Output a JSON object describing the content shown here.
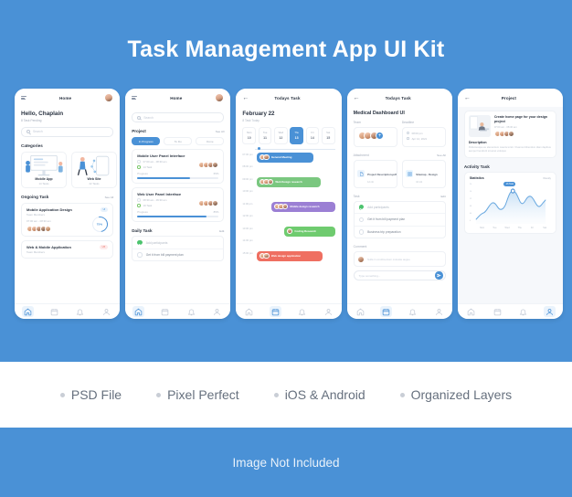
{
  "hero": {
    "title": "Task Management App UI Kit"
  },
  "features": [
    {
      "label": "PSD File"
    },
    {
      "label": "Pixel Perfect"
    },
    {
      "label": "iOS & Android"
    },
    {
      "label": "Organized Layers"
    }
  ],
  "footer": {
    "text": "Image Not Included"
  },
  "colors": {
    "background_blue": "#4a91d6",
    "accent": "#4a91d6",
    "card_white": "#ffffff",
    "screen_bg": "#f6f8fb",
    "muted_text": "#b2bac6",
    "green": "#7ac77f",
    "purple": "#9b7fd4",
    "red": "#ef6f61"
  },
  "screens": [
    {
      "id": "home",
      "topbar": {
        "title": "Home",
        "left_icon": "hamburger-icon",
        "right_icon": "avatar"
      },
      "greeting": "Hello, Chaplain",
      "greeting_sub": "8 Task Pending",
      "search_placeholder": "Search",
      "categories_title": "Categories",
      "categories": [
        {
          "name": "Mobile App",
          "count": "14 Tasks"
        },
        {
          "name": "Web Site",
          "count": "22 Tasks"
        }
      ],
      "ongoing_title": "Ongoing Task",
      "ongoing_link": "See All",
      "tasks": [
        {
          "title": "Mobile Application Design",
          "sub": "Team Members",
          "time": "07:00 am - 08:30 am",
          "badge": "UI",
          "progress": "75%"
        },
        {
          "title": "Web & Mobile Application",
          "sub": "Team Members",
          "badge": "UX"
        }
      ],
      "nav": [
        "home-icon",
        "calendar-icon",
        "bell-icon",
        "profile-icon"
      ],
      "nav_active": 0
    },
    {
      "id": "project",
      "topbar": {
        "title": "Home",
        "left_icon": "hamburger-icon",
        "right_icon": "avatar"
      },
      "search_placeholder": "Search",
      "project_title": "Project",
      "project_link": "See All",
      "chips": [
        {
          "label": "In Progress",
          "active": true
        },
        {
          "label": "To Do",
          "active": false
        },
        {
          "label": "Done",
          "active": false
        }
      ],
      "projects": [
        {
          "title": "Mobile User Panel Interface",
          "time": "07:00 am - 08:30 am",
          "tasks": "14 Task",
          "progress_label": "Progress",
          "progress": "65%",
          "progress_pct": 65
        },
        {
          "title": "Web User Panel Interface",
          "time": "08:30 am - 09:30 am",
          "tasks": "19 Task",
          "progress_label": "Progress",
          "progress": "85%",
          "progress_pct": 85
        }
      ],
      "daily_title": "Daily Task",
      "daily_link": "Edit",
      "daily_items": [
        {
          "label": "Add participants",
          "done": true
        },
        {
          "label": "Get it from bill payment plan",
          "done": false
        }
      ],
      "nav": [
        "home-icon",
        "calendar-icon",
        "bell-icon",
        "profile-icon"
      ],
      "nav_active": 0
    },
    {
      "id": "todays-task-calendar",
      "topbar": {
        "title": "Todays Task",
        "left_icon": "back-arrow-icon"
      },
      "month_title": "February 22",
      "month_sub": "8 Task Today",
      "days": [
        {
          "name": "Mon",
          "num": "10",
          "selected": false
        },
        {
          "name": "Tue",
          "num": "11",
          "selected": false
        },
        {
          "name": "Wed",
          "num": "12",
          "selected": false
        },
        {
          "name": "Thu",
          "num": "13",
          "selected": true
        },
        {
          "name": "Fri",
          "num": "14",
          "selected": false
        },
        {
          "name": "Sat",
          "num": "15",
          "selected": false
        }
      ],
      "timeline": [
        {
          "time": "07:00 pm",
          "event": "General Meeting",
          "color": "#4a91d6",
          "indent": 0,
          "width": 62,
          "faces": 2
        },
        {
          "time": "08:00 pm",
          "event": "",
          "color": "",
          "indent": 0,
          "width": 0,
          "faces": 0
        },
        {
          "time": "09:00 pm",
          "event": "Web Design research",
          "color": "#7ac77f",
          "indent": 0,
          "width": 70,
          "faces": 3
        },
        {
          "time": "10:00 pm",
          "event": "",
          "color": "",
          "indent": 0,
          "width": 0,
          "faces": 0
        },
        {
          "time": "11:00 pm",
          "event": "Mobile design research",
          "color": "#9b7fd4",
          "indent": 16,
          "width": 70,
          "faces": 3
        },
        {
          "time": "12:00 pm",
          "event": "",
          "color": "",
          "indent": 0,
          "width": 0,
          "faces": 0
        },
        {
          "time": "13:00 pm",
          "event": "Coding Research",
          "color": "#6fcb6f",
          "indent": 30,
          "width": 58,
          "faces": 1
        },
        {
          "time": "14:00 pm",
          "event": "",
          "color": "",
          "indent": 0,
          "width": 0,
          "faces": 0
        },
        {
          "time": "15:00 pm",
          "event": "Web design application",
          "color": "#ef6f61",
          "indent": 0,
          "width": 72,
          "faces": 2
        }
      ],
      "nav": [
        "home-icon",
        "calendar-icon",
        "bell-icon",
        "profile-icon"
      ],
      "nav_active": 1
    },
    {
      "id": "task-detail",
      "topbar": {
        "title": "Todays Task",
        "left_icon": "back-arrow-icon"
      },
      "detail_title": "Medical Dashboard UI",
      "team_label": "Team",
      "deadline_label": "Deadline",
      "deadline_time": "08:00 pm",
      "deadline_date": "Apr 12, 2021",
      "attachment_title": "Attachment",
      "attachment_link": "See All",
      "attachments": [
        {
          "name": "Project Description.pdf",
          "size": "12 mb",
          "icon": "pdf-file-icon"
        },
        {
          "name": "Sitemap - Design",
          "size": "10 mb",
          "icon": "sitemap-icon"
        }
      ],
      "task_title": "Task",
      "task_link": "Edit",
      "task_items": [
        {
          "label": "Add participants",
          "done": true
        },
        {
          "label": "Get it from bill payment plan",
          "done": false
        },
        {
          "label": "Business trip preparation",
          "done": false
        }
      ],
      "comment_title": "Comment",
      "comment_placeholder": "Nulla in condimentum molestie augue",
      "composer_placeholder": "Type something...",
      "send_icon": "send-icon",
      "nav": [
        "home-icon",
        "calendar-icon",
        "bell-icon",
        "profile-icon"
      ],
      "nav_active": 1
    },
    {
      "id": "project-detail",
      "topbar": {
        "title": "Project",
        "left_icon": "back-arrow-icon"
      },
      "project_name": "Create home page for your design project",
      "project_time": "07:00 am - 08:30 am",
      "description_title": "Description",
      "description_text": "Pellentesque eu elementum mauris tortor. Vivamus bibendum diam dapibus semper hendrerit sit amet volutpat.",
      "activity_title": "Activity Task",
      "statistics_title": "Statistics",
      "statistics_select": "Weekly",
      "tooltip": "16 Task",
      "nav": [
        "home-icon",
        "calendar-icon",
        "bell-icon",
        "profile-icon"
      ],
      "nav_active": 3
    }
  ],
  "chart_data": {
    "type": "line",
    "title": "Statistics",
    "subtitle": "Weekly",
    "xlabel": "",
    "ylabel": "",
    "categories": [
      "Mon",
      "Tue",
      "Wed",
      "Thu",
      "Fri",
      "Sat"
    ],
    "x_tick_labels": [
      "Mon",
      "Tue",
      "Wed",
      "Thu",
      "Fri",
      "Sat"
    ],
    "y_tick_labels": [
      "0",
      "04",
      "08",
      "12",
      "16",
      "20"
    ],
    "ylim": [
      0,
      20
    ],
    "values": [
      4,
      5,
      11,
      9,
      8,
      17,
      16,
      11,
      13,
      9,
      7,
      14,
      13,
      11
    ],
    "series": [
      {
        "name": "Task",
        "values": [
          4,
          5,
          11,
          9,
          8,
          17,
          16,
          11,
          13,
          9,
          7,
          14,
          13,
          11
        ]
      }
    ],
    "highlight_point": {
      "label": "16 Task",
      "x_index": 5,
      "value": 17
    },
    "grid": false,
    "legend": "none",
    "fill": true,
    "line_color": "#4a91d6",
    "fill_color": "#dceaf8"
  }
}
